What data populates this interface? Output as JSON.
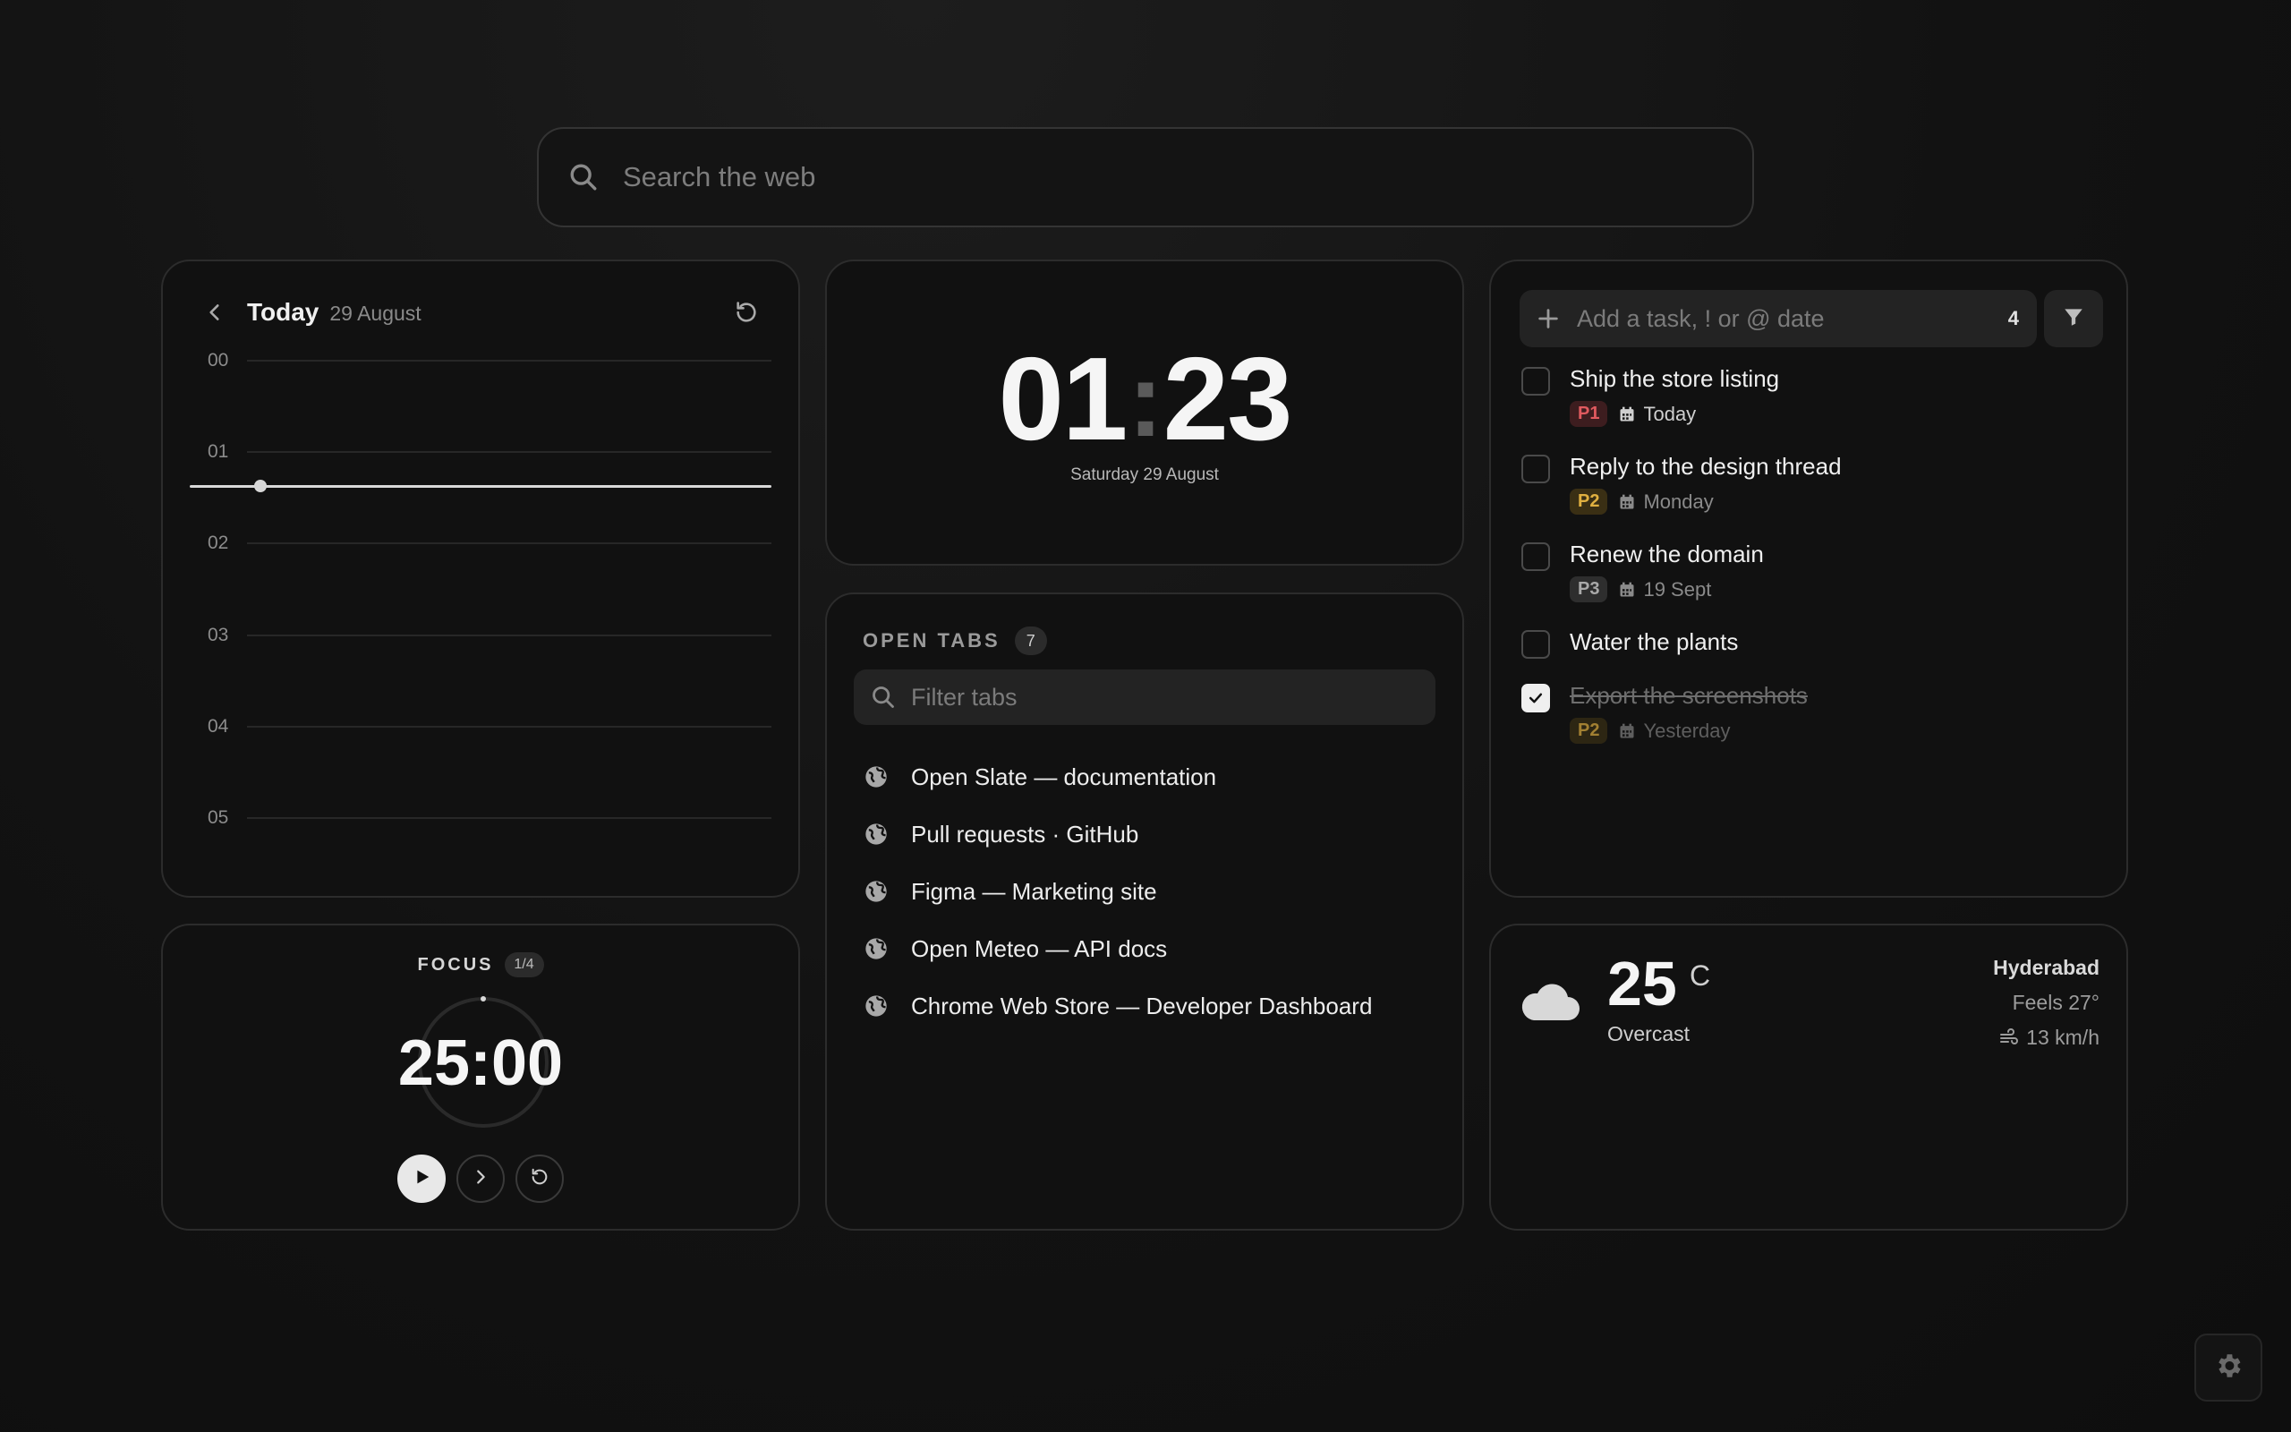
{
  "search": {
    "placeholder": "Search the web"
  },
  "calendar": {
    "title": "Today",
    "date": "29 August",
    "hours": [
      "00",
      "01",
      "02",
      "03",
      "04",
      "05"
    ]
  },
  "clock": {
    "hours": "01",
    "minutes": "23",
    "date": "Saturday 29 August"
  },
  "tabs": {
    "label": "OPEN TABS",
    "count": "7",
    "filter_placeholder": "Filter tabs",
    "items": [
      "Open Slate — documentation",
      "Pull requests · GitHub",
      "Figma — Marketing site",
      "Open Meteo — API docs",
      "Chrome Web Store — Developer Dashboard"
    ]
  },
  "tasks": {
    "placeholder": "Add a task, ! or @ date",
    "count": "4",
    "items": [
      {
        "title": "Ship the store listing",
        "priority": "P1",
        "due": "Today",
        "done": false
      },
      {
        "title": "Reply to the design thread",
        "priority": "P2",
        "due": "Monday",
        "done": false
      },
      {
        "title": "Renew the domain",
        "priority": "P3",
        "due": "19 Sept",
        "done": false
      },
      {
        "title": "Water the plants",
        "done": false
      },
      {
        "title": "Export the screenshots",
        "priority": "P2",
        "due": "Yesterday",
        "done": true
      }
    ]
  },
  "focus": {
    "label": "FOCUS",
    "session": "1/4",
    "time": "25:00"
  },
  "weather": {
    "temp": "25",
    "unit": "C",
    "condition": "Overcast",
    "city": "Hyderabad",
    "feels": "Feels 27°",
    "wind": "13 km/h",
    "icon": "cloud-icon"
  },
  "colors": {
    "background": "#121212",
    "card": "#111111",
    "border": "#2c2c2c",
    "p1": "#e05a5f",
    "p2": "#e0b040",
    "p3": "#a9a9a9"
  }
}
